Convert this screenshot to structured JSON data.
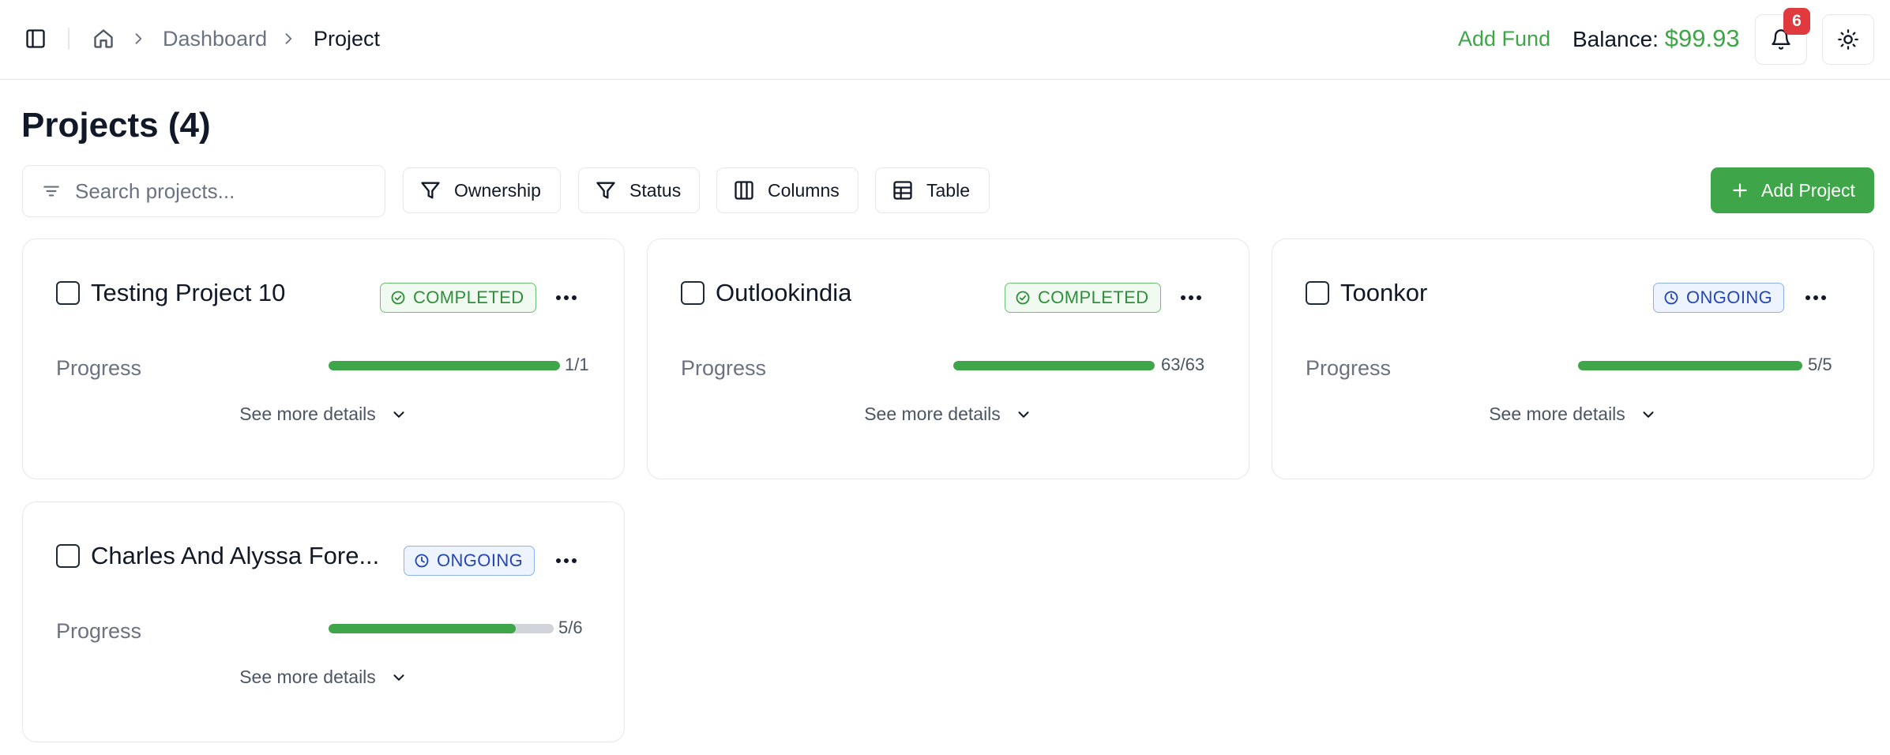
{
  "breadcrumb": {
    "items": [
      "Dashboard"
    ],
    "current": "Project"
  },
  "header": {
    "add_fund_label": "Add Fund",
    "balance_label": "Balance:",
    "balance_amount": "$99.93",
    "notification_count": "6"
  },
  "page": {
    "title": "Projects (4)"
  },
  "toolbar": {
    "search_placeholder": "Search projects...",
    "search_value": "",
    "ownership_label": "Ownership",
    "status_label": "Status",
    "columns_label": "Columns",
    "table_label": "Table",
    "add_project_label": "Add Project"
  },
  "projects": [
    {
      "name": "Testing Project 10",
      "status": "COMPLETED",
      "progress_label": "Progress",
      "progress_text": "1/1",
      "progress_fraction": 1.0,
      "details_label": "See more details"
    },
    {
      "name": "Outlookindia",
      "status": "COMPLETED",
      "progress_label": "Progress",
      "progress_text": "63/63",
      "progress_fraction": 1.0,
      "details_label": "See more details"
    },
    {
      "name": "Toonkor",
      "status": "ONGOING",
      "progress_label": "Progress",
      "progress_text": "5/5",
      "progress_fraction": 1.0,
      "details_label": "See more details"
    },
    {
      "name": "Charles And Alyssa Fore...",
      "status": "ONGOING",
      "progress_label": "Progress",
      "progress_text": "5/6",
      "progress_fraction": 0.8333,
      "details_label": "See more details"
    }
  ],
  "colors": {
    "accent_green": "#3ea649",
    "completed_text": "#2f8f3a",
    "ongoing_text": "#2447b3",
    "notification_badge": "#e0393e"
  },
  "icons": {
    "sidebar_toggle": "sidebar-panel-icon",
    "home": "home-icon",
    "breadcrumb_separator": "chevron-right-icon",
    "notifications": "bell-icon",
    "theme": "sun-icon",
    "search": "filter-lines-icon",
    "ownership": "funnel-icon",
    "status": "funnel-icon",
    "columns": "columns-icon",
    "table": "table-icon",
    "add": "plus-icon",
    "completed_status": "check-circle-icon",
    "ongoing_status": "clock-icon",
    "more": "ellipsis-icon",
    "expand": "chevron-down-icon"
  }
}
